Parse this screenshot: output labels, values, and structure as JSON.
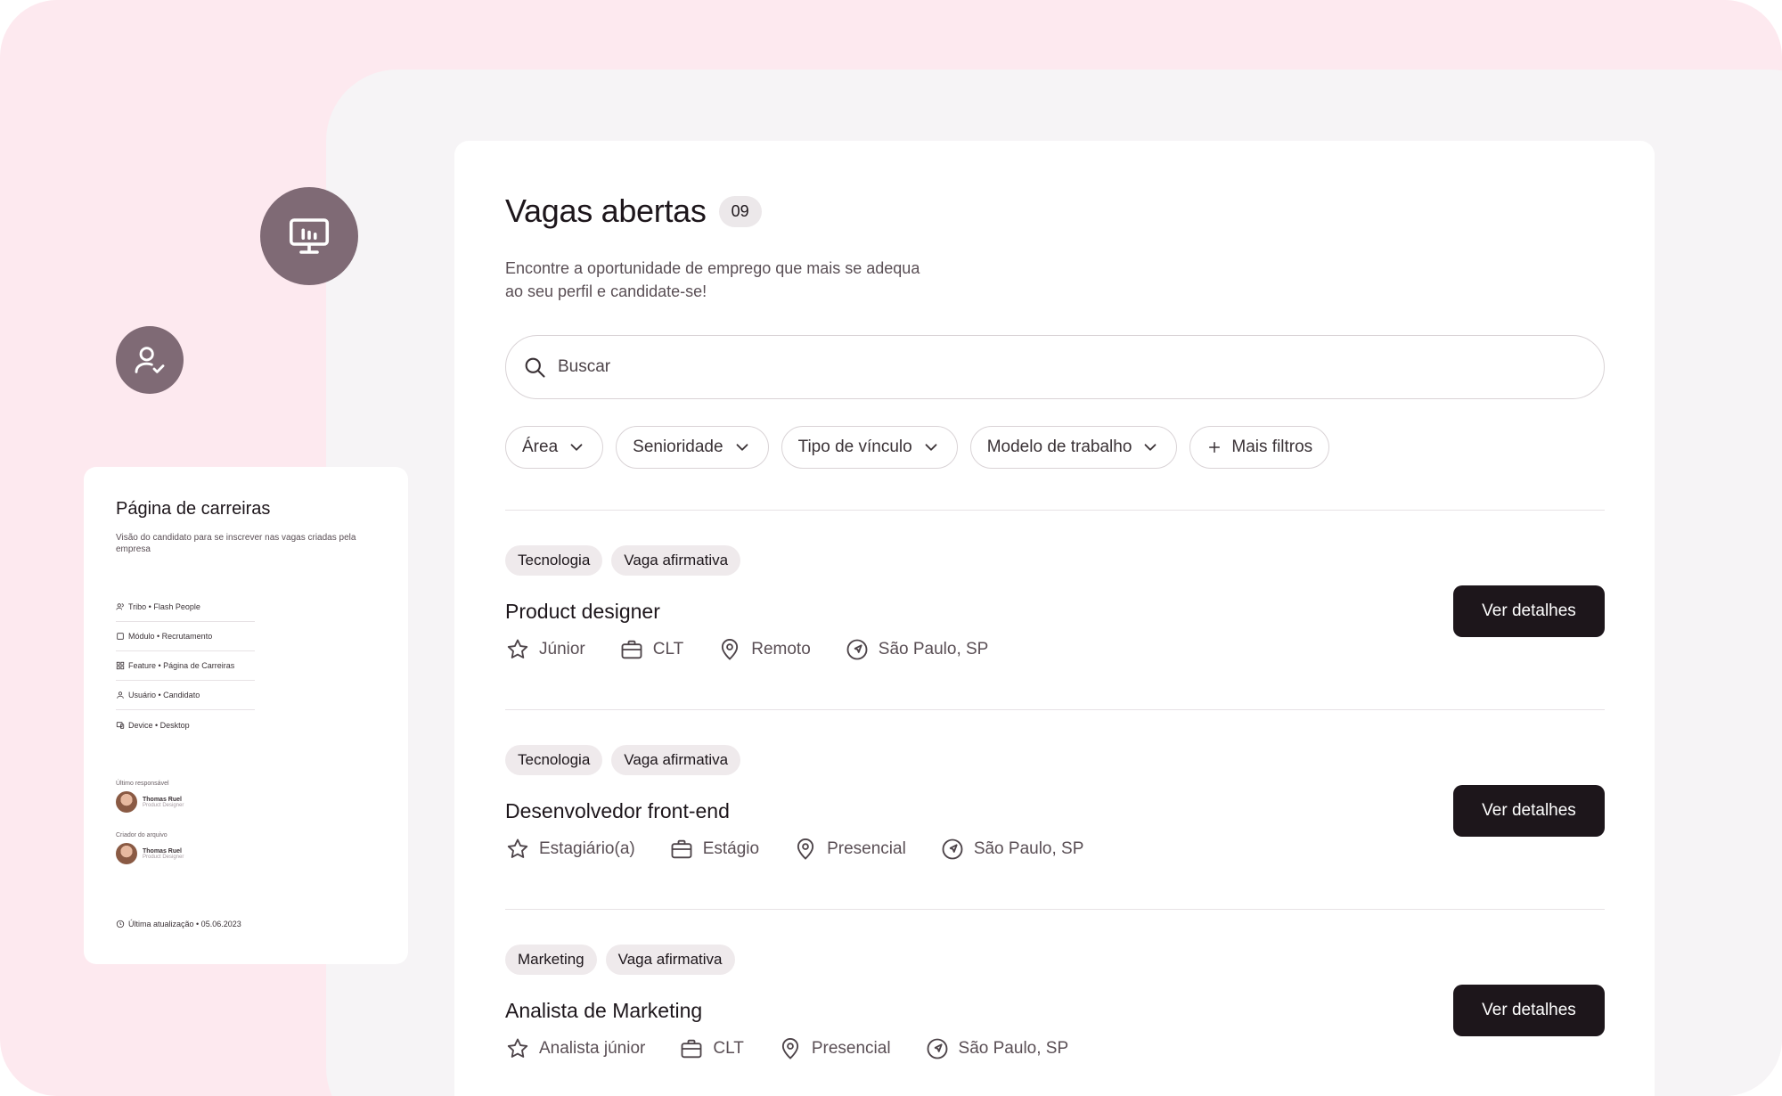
{
  "doc_card": {
    "title": "Página de carreiras",
    "description": "Visão do candidato para se inscrever nas vagas criadas pela empresa",
    "meta": [
      {
        "icon": "people-icon",
        "label": "Tribo • Flash People"
      },
      {
        "icon": "square-icon",
        "label": "Módulo • Recrutamento"
      },
      {
        "icon": "grid-icon",
        "label": "Feature • Página de Carreiras"
      },
      {
        "icon": "user-icon",
        "label": "Usuário • Candidato"
      },
      {
        "icon": "device-icon",
        "label": "Device • Desktop"
      }
    ],
    "last_owner_label": "Último responsável",
    "creator_label": "Criador do arquivo",
    "person_name": "Thomas Ruel",
    "person_role": "Product Designer",
    "updated": "Última atualização • 05.06.2023"
  },
  "header": {
    "title": "Vagas abertas",
    "count": "09",
    "subtitle_line1": "Encontre a oportunidade de emprego que mais se adequa",
    "subtitle_line2": "ao seu perfil e candidate-se!"
  },
  "search": {
    "placeholder": "Buscar"
  },
  "filters": {
    "area": "Área",
    "seniority": "Senioridade",
    "contract": "Tipo de vínculo",
    "work_model": "Modelo de trabalho",
    "more": "Mais filtros"
  },
  "jobs": [
    {
      "tags": [
        "Tecnologia",
        "Vaga afirmativa"
      ],
      "title": "Product designer",
      "level": "Júnior",
      "contract": "CLT",
      "model": "Remoto",
      "location": "São Paulo, SP",
      "button": "Ver detalhes"
    },
    {
      "tags": [
        "Tecnologia",
        "Vaga afirmativa"
      ],
      "title": "Desenvolvedor front-end",
      "level": "Estagiário(a)",
      "contract": "Estágio",
      "model": "Presencial",
      "location": "São Paulo, SP",
      "button": "Ver detalhes"
    },
    {
      "tags": [
        "Marketing",
        "Vaga afirmativa"
      ],
      "title": "Analista de Marketing",
      "level": "Analista júnior",
      "contract": "CLT",
      "model": "Presencial",
      "location": "São Paulo, SP",
      "button": "Ver detalhes"
    }
  ],
  "colors": {
    "background_pink": "#fde9ef",
    "panel_gray": "#f6f4f6",
    "icon_circle": "#7f6a75",
    "primary_button": "#1d161b"
  }
}
